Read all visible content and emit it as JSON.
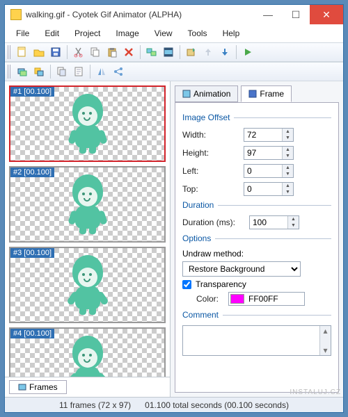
{
  "window": {
    "title": "walking.gif - Cyotek Gif Animator (ALPHA)"
  },
  "menu": [
    "File",
    "Edit",
    "Project",
    "Image",
    "View",
    "Tools",
    "Help"
  ],
  "frames": [
    {
      "label": "#1 [00.100]",
      "selected": true
    },
    {
      "label": "#2 [00.100]",
      "selected": false
    },
    {
      "label": "#3 [00.100]",
      "selected": false
    },
    {
      "label": "#4 [00.100]",
      "selected": false
    }
  ],
  "bottom_tab": "Frames",
  "right_tabs": {
    "animation": "Animation",
    "frame": "Frame"
  },
  "panel": {
    "image_offset": {
      "title": "Image Offset",
      "width_label": "Width:",
      "width_value": "72",
      "height_label": "Height:",
      "height_value": "97",
      "left_label": "Left:",
      "left_value": "0",
      "top_label": "Top:",
      "top_value": "0"
    },
    "duration": {
      "title": "Duration",
      "label": "Duration (ms):",
      "value": "100"
    },
    "options": {
      "title": "Options",
      "undraw_label": "Undraw method:",
      "undraw_value": "Restore Background",
      "transparency_label": "Transparency",
      "color_label": "Color:",
      "color_value": "FF00FF"
    },
    "comment": {
      "title": "Comment"
    }
  },
  "status": {
    "frames": "11 frames (72 x 97)",
    "total": "01.100 total seconds (00.100 seconds)"
  },
  "watermark": "INSTALUJ.CZ"
}
